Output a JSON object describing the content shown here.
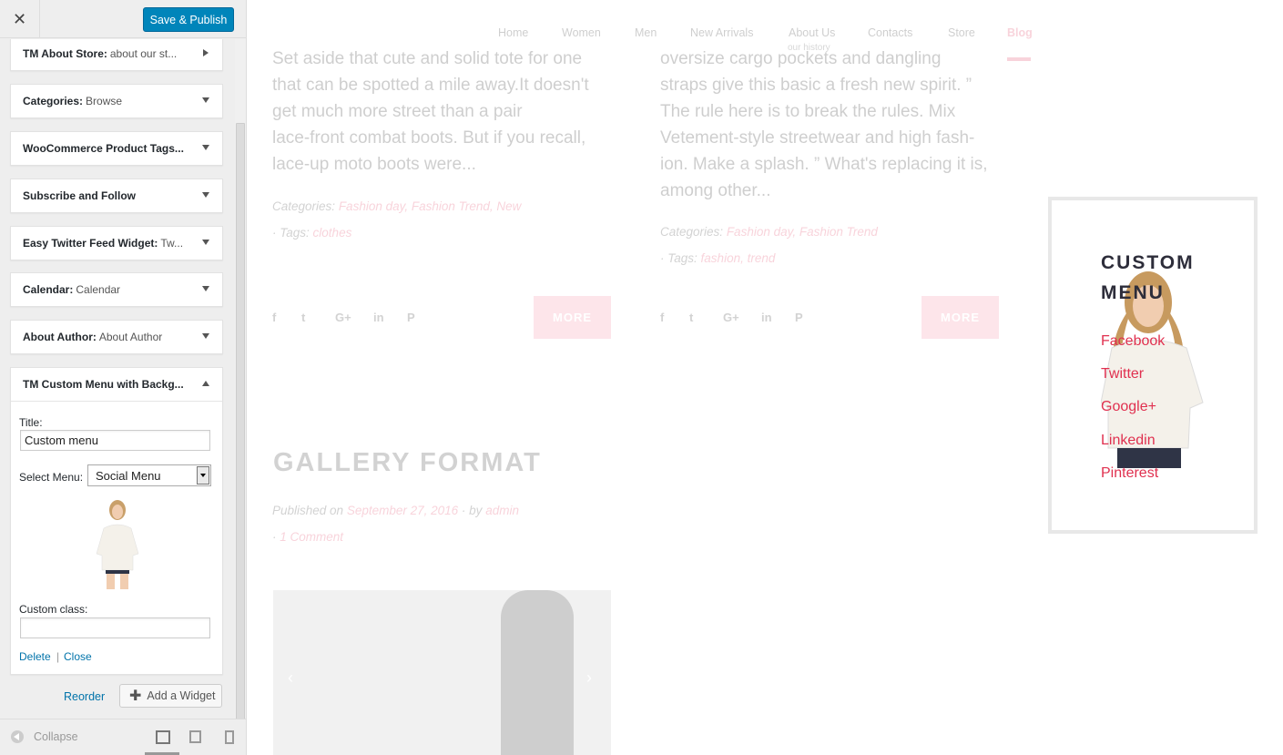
{
  "sidebar": {
    "close_icon": "close-icon",
    "publish_label": "Save & Publish",
    "widgets": [
      {
        "name": "TM About Store",
        "sub": "about our st...",
        "state": "right"
      },
      {
        "name": "Categories",
        "sub": "Browse",
        "state": "down"
      },
      {
        "name": "WooCommerce Product Tags...",
        "sub": "",
        "state": "down"
      },
      {
        "name": "Subscribe and Follow",
        "sub": "",
        "state": "down"
      },
      {
        "name": "Easy Twitter Feed Widget",
        "sub": "Tw...",
        "state": "down"
      },
      {
        "name": "Calendar",
        "sub": "Calendar",
        "state": "down"
      },
      {
        "name": "About Author",
        "sub": "About Author",
        "state": "down"
      },
      {
        "name": "TM Custom Menu with Backg...",
        "sub": "",
        "state": "up"
      }
    ],
    "open_widget": {
      "title_label": "Title:",
      "title_value": "Custom menu",
      "select_label": "Select Menu:",
      "select_value": "Social Menu",
      "custom_class_label": "Custom class:",
      "custom_class_value": "",
      "delete_label": "Delete",
      "separator": "|",
      "close_label": "Close"
    },
    "reorder_label": "Reorder",
    "add_widget_label": "Add a Widget",
    "collapse_label": "Collapse"
  },
  "preview": {
    "nav": [
      "Home",
      "Women",
      "Men",
      "New Arrivals",
      "About Us",
      "Contacts",
      "Store",
      "Blog"
    ],
    "nav_sub": "our history",
    "posts": [
      {
        "lines": [
          "Set aside that cute and solid tote for one",
          "that can be spotted a mile away.It doesn't",
          "get much more street than a pair",
          "lace-front combat boots. But if you recall,",
          "lace-up moto boots were..."
        ],
        "categories_label": "Categories:",
        "categories": "Fashion day, Fashion Trend, New",
        "tags_label": "Tags:",
        "tags": "clothes",
        "more": "MORE"
      },
      {
        "lines": [
          "oversize cargo pockets and dangling",
          "straps give this basic a fresh new spirit. ”",
          "The rule here is to break the rules. Mix",
          "Vetement-style streetwear and high fash-",
          "ion. Make a splash. ” What's replacing it is,",
          "among other..."
        ],
        "categories_label": "Categories:",
        "categories": "Fashion day, Fashion Trend",
        "tags_label": "Tags:",
        "tags": "fashion, trend",
        "more": "MORE"
      }
    ],
    "gallery_title": "GALLERY FORMAT",
    "published_on": "Published on",
    "date": "September 27, 2016",
    "by": "by",
    "author": "admin",
    "comments": "1 Comment",
    "custom_menu": {
      "title": "CUSTOM MENU",
      "links": [
        "Facebook",
        "Twitter",
        "Google+",
        "Linkedin",
        "Pinterest"
      ]
    }
  }
}
